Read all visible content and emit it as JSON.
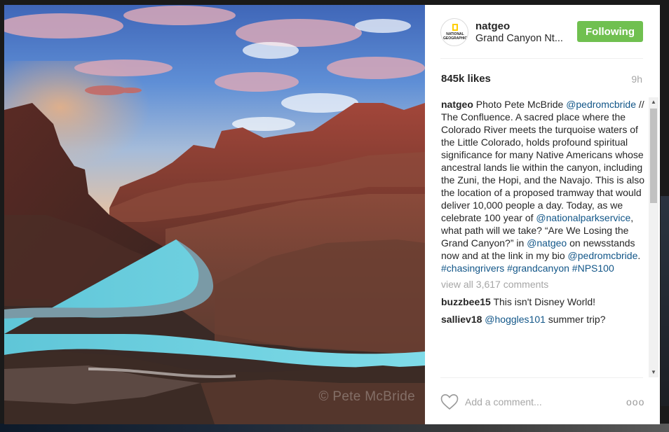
{
  "post": {
    "username": "natgeo",
    "location": "Grand Canyon Nt...",
    "follow_label": "Following",
    "likes": "845k likes",
    "time": "9h",
    "avatar_text": "NATIONAL GEOGRAPHIC",
    "watermark": "© Pete McBride"
  },
  "caption": {
    "author": "natgeo",
    "t1": " Photo Pete McBride ",
    "m1": "@pedromcbride",
    "t2": " // The Confluence. A sacred place where the Colorado River meets the turquoise waters of the Little Colorado, holds profound spiritual significance for many Native Americans whose ancestral lands lie within the canyon, including the Zuni, the Hopi, and the Navajo. This is also the location of a proposed tramway that would deliver 10,000 people a day. Today, as we celebrate 100 year of ",
    "m2": "@nationalparkservice",
    "t3": ", what path will we take? “Are We Losing the Grand Canyon?” in ",
    "m3": "@natgeo",
    "t4": " on newsstands now and at the link in my bio ",
    "m4": "@pedromcbride",
    "t5": ". ",
    "h1": "#chasingrivers",
    "h2": "#grandcanyon",
    "h3": "#NPS100"
  },
  "view_all": "view all 3,617 comments",
  "comments": [
    {
      "user": "buzzbee15",
      "mention": "",
      "text": "This isn't Disney World!"
    },
    {
      "user": "salliev18",
      "mention": "@hoggles101",
      "text": "summer trip?"
    }
  ],
  "footer": {
    "placeholder": "Add a comment...",
    "more": "ooo"
  },
  "colors": {
    "follow_green": "#70c050",
    "link_blue": "#125688",
    "muted_gray": "#a6a6a6"
  },
  "icons": [
    "heart-icon",
    "more-options-icon",
    "natgeo-avatar",
    "scroll-up-icon",
    "scroll-down-icon"
  ]
}
